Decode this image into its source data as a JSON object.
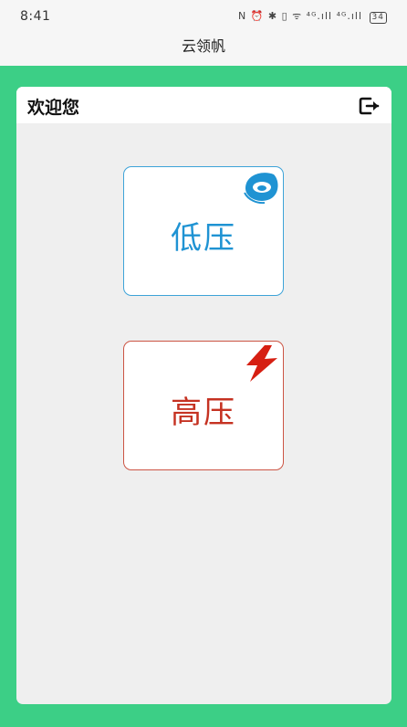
{
  "status_bar": {
    "time": "8:41",
    "icons_text": "N ⏰ ✱ ▯ ᯤ ⁴ᴳ.ıll ⁴ᴳ.ıll",
    "battery": "34"
  },
  "title_bar": {
    "title": "云领帆"
  },
  "panel": {
    "welcome": "欢迎您",
    "logout_icon": "logout-icon"
  },
  "cards": {
    "low": {
      "label": "低压",
      "icon": "swirl-icon",
      "color": "#1f93d3"
    },
    "high": {
      "label": "高压",
      "icon": "lightning-icon",
      "color": "#c53222"
    }
  },
  "colors": {
    "background": "#3ccf86",
    "panel": "#efefef"
  }
}
